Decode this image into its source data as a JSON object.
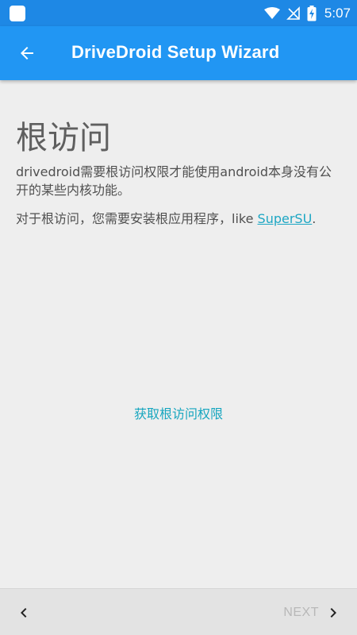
{
  "status_bar": {
    "time": "5:07",
    "battery_level": "5"
  },
  "app_bar": {
    "title": "DriveDroid Setup Wizard"
  },
  "content": {
    "heading": "根访问",
    "description": "drivedroid需要根访问权限才能使用android本身没有公开的某些内核功能。",
    "note_prefix": "对于根访问，您需要安装根应用程序，like ",
    "note_link": "SuperSU",
    "note_suffix": ".",
    "action": "获取根访问权限"
  },
  "bottom_bar": {
    "next_label": "NEXT"
  },
  "colors": {
    "status_bar": "#1e88e5",
    "app_bar": "#2196f3",
    "link": "#1ea7c4",
    "action": "#17a6bf"
  }
}
